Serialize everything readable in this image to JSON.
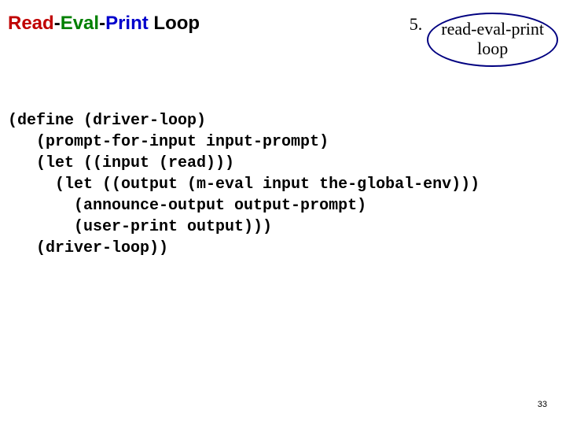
{
  "header": {
    "title_words": {
      "read": "Read",
      "dash1": "-",
      "eval": "Eval",
      "dash2": "-",
      "print": "Print",
      "loop": " Loop"
    },
    "badge_number": "5.",
    "badge_line1": "read-eval-print",
    "badge_line2": "loop"
  },
  "code": {
    "l1": "(define (driver-loop)",
    "l2": "   (prompt-for-input input-prompt)",
    "l3": "   (let ((input (read)))",
    "l4": "     (let ((output (m-eval input the-global-env)))",
    "l5": "       (announce-output output-prompt)",
    "l6": "       (user-print output)))",
    "l7": "   (driver-loop))"
  },
  "page_number": "33"
}
